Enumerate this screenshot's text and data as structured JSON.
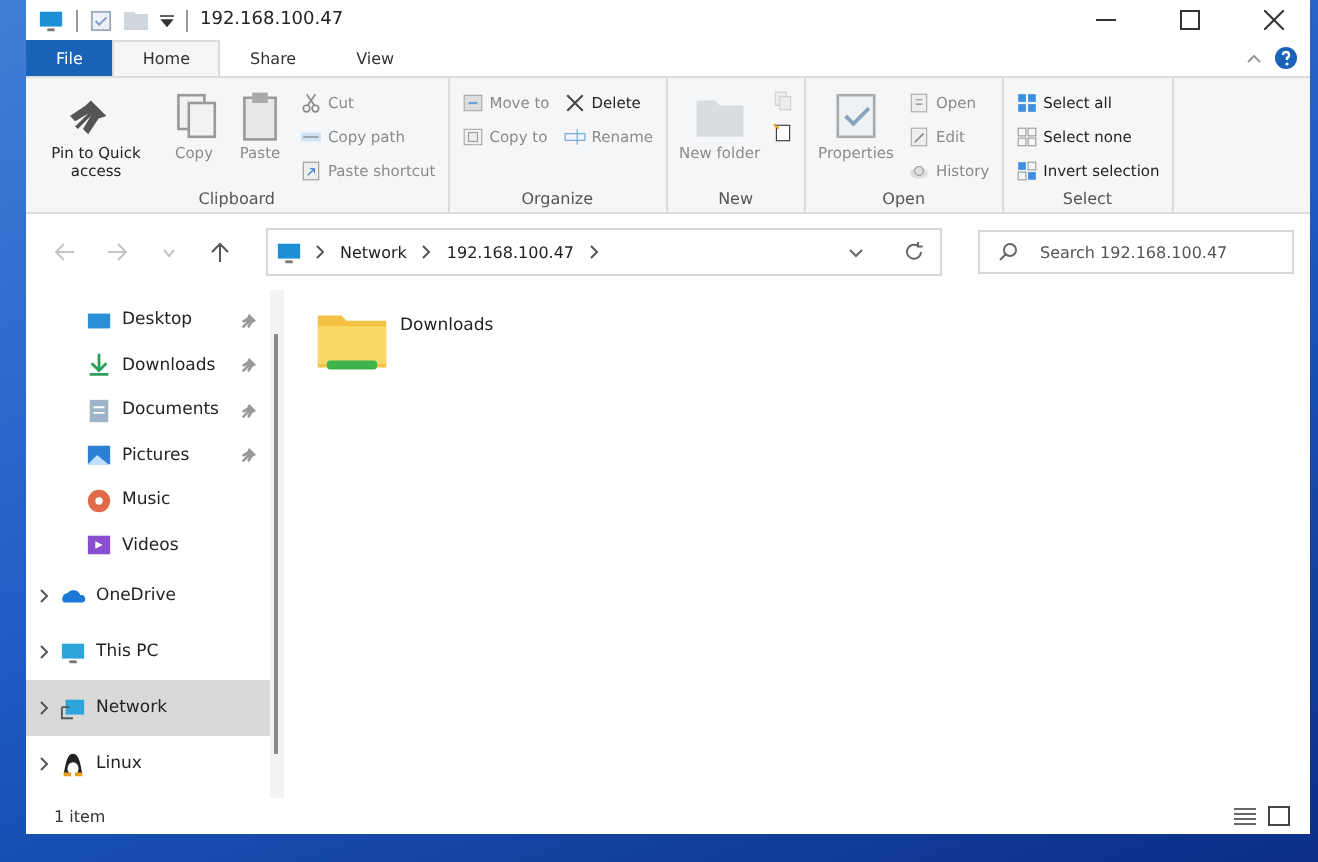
{
  "window": {
    "title": "192.168.100.47"
  },
  "tabs": [
    {
      "label": "File",
      "kind": "file",
      "selected": false
    },
    {
      "label": "Home",
      "kind": "tab",
      "selected": true
    },
    {
      "label": "Share",
      "kind": "tab",
      "selected": false
    },
    {
      "label": "View",
      "kind": "tab",
      "selected": false
    }
  ],
  "ribbon": {
    "groups": [
      {
        "label": "Clipboard",
        "items": [
          {
            "kind": "large",
            "label": "Pin to Quick access",
            "disabled": false
          },
          {
            "kind": "large",
            "label": "Copy",
            "disabled": true
          },
          {
            "kind": "large",
            "label": "Paste",
            "disabled": true
          },
          {
            "kind": "small",
            "label": "Cut",
            "disabled": true
          },
          {
            "kind": "small",
            "label": "Copy path",
            "disabled": true
          },
          {
            "kind": "small",
            "label": "Paste shortcut",
            "disabled": true
          }
        ]
      },
      {
        "label": "Organize",
        "items": [
          {
            "kind": "small",
            "label": "Move to",
            "disabled": true
          },
          {
            "kind": "small",
            "label": "Copy to",
            "disabled": true
          },
          {
            "kind": "small",
            "label": "Delete",
            "disabled": false
          },
          {
            "kind": "small",
            "label": "Rename",
            "disabled": true
          }
        ]
      },
      {
        "label": "New",
        "items": [
          {
            "kind": "large",
            "label": "New folder",
            "disabled": true
          },
          {
            "kind": "icon",
            "disabled": true
          },
          {
            "kind": "icon",
            "disabled": false
          }
        ]
      },
      {
        "label": "Open",
        "items": [
          {
            "kind": "large",
            "label": "Properties",
            "disabled": true
          },
          {
            "kind": "small",
            "label": "Open",
            "disabled": true
          },
          {
            "kind": "small",
            "label": "Edit",
            "disabled": true
          },
          {
            "kind": "small",
            "label": "History",
            "disabled": true
          }
        ]
      },
      {
        "label": "Select",
        "items": [
          {
            "kind": "small",
            "label": "Select all",
            "disabled": false
          },
          {
            "kind": "small",
            "label": "Select none",
            "disabled": false
          },
          {
            "kind": "small",
            "label": "Invert selection",
            "disabled": false
          }
        ]
      }
    ]
  },
  "address": {
    "crumbs": [
      "Network",
      "192.168.100.47"
    ]
  },
  "search": {
    "placeholder": "Search 192.168.100.47"
  },
  "sidebar": {
    "items": [
      {
        "label": "Desktop",
        "kind": "quick",
        "pinned": true,
        "selected": false
      },
      {
        "label": "Downloads",
        "kind": "quick",
        "pinned": true,
        "selected": false
      },
      {
        "label": "Documents",
        "kind": "quick",
        "pinned": true,
        "selected": false
      },
      {
        "label": "Pictures",
        "kind": "quick",
        "pinned": true,
        "selected": false
      },
      {
        "label": "Music",
        "kind": "quick",
        "pinned": false,
        "selected": false
      },
      {
        "label": "Videos",
        "kind": "quick",
        "pinned": false,
        "selected": false
      },
      {
        "label": "OneDrive",
        "kind": "root",
        "selected": false
      },
      {
        "label": "This PC",
        "kind": "root",
        "selected": false
      },
      {
        "label": "Network",
        "kind": "root",
        "selected": true
      },
      {
        "label": "Linux",
        "kind": "root",
        "selected": false
      }
    ]
  },
  "files": [
    {
      "name": "Downloads"
    }
  ],
  "status_bar": {
    "count": "1 item"
  }
}
